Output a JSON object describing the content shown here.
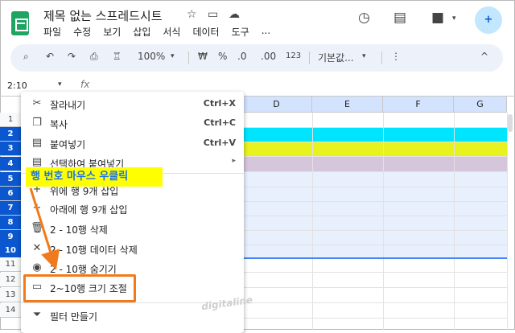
{
  "app": {
    "doc_title": "제목 없는 스프레드시트",
    "title_icons": [
      "star-icon",
      "move-folder-icon",
      "cloud-status-icon"
    ],
    "menu": [
      "파일",
      "수정",
      "보기",
      "삽입",
      "서식",
      "데이터",
      "도구",
      "..."
    ],
    "right_icons": [
      "history-icon",
      "comment-icon",
      "meet-video-icon",
      "share-person-add-icon"
    ],
    "meet_caret": "▾",
    "share_glyph": "+"
  },
  "toolbar": {
    "zoom": "100%",
    "currency": "₩",
    "percent": "%",
    "decrease_decimal": ".0",
    "increase_decimal": ".00",
    "number_format": "123",
    "font_select": "기본값...",
    "more": "⋮",
    "collapse": "^",
    "caret": "▾"
  },
  "formula_bar": {
    "name_box": "2:10",
    "name_box_caret": "▾",
    "fx_label": "fx"
  },
  "grid": {
    "columns": [
      "D",
      "E",
      "F",
      "G"
    ],
    "rows": [
      {
        "label": "1",
        "selected": false
      },
      {
        "label": "2",
        "selected": true
      },
      {
        "label": "3",
        "selected": true
      },
      {
        "label": "4",
        "selected": true
      },
      {
        "label": "5",
        "selected": true
      },
      {
        "label": "6",
        "selected": true
      },
      {
        "label": "7",
        "selected": true
      },
      {
        "label": "8",
        "selected": true
      },
      {
        "label": "9",
        "selected": true
      },
      {
        "label": "10",
        "selected": true
      },
      {
        "label": "11",
        "selected": false
      },
      {
        "label": "12",
        "selected": false
      },
      {
        "label": "13",
        "selected": false
      },
      {
        "label": "14",
        "selected": false
      }
    ],
    "row_fill_colors": {
      "row2": "#00e5ff",
      "row3": "#e8f21e",
      "row4": "#d5c6dc"
    }
  },
  "context_menu": {
    "items": [
      {
        "label": "잘라내기",
        "shortcut": "Ctrl+X",
        "icon": "cut-icon"
      },
      {
        "label": "복사",
        "shortcut": "Ctrl+C",
        "icon": "copy-icon"
      },
      {
        "label": "붙여넣기",
        "shortcut": "Ctrl+V",
        "icon": "paste-icon"
      },
      {
        "label": "선택하여 붙여넣기",
        "shortcut": "▸",
        "icon": "paste-special-icon"
      },
      {
        "label": "위에 행 9개 삽입",
        "shortcut": "",
        "icon": "plus-icon"
      },
      {
        "label": "아래에 행 9개 삽입",
        "shortcut": "",
        "icon": "plus-icon"
      },
      {
        "label": "2 - 10행 삭제",
        "shortcut": "",
        "icon": "trash-icon"
      },
      {
        "label": "2 - 10행 데이터 삭제",
        "shortcut": "",
        "icon": "close-icon"
      },
      {
        "label": "2 - 10행 숨기기",
        "shortcut": "",
        "icon": "eye-hidden-icon"
      },
      {
        "label": "2~10행 크기 조절",
        "shortcut": "",
        "icon": "resize-icon"
      },
      {
        "label": "필터 만들기",
        "shortcut": "",
        "icon": "filter-icon"
      }
    ]
  },
  "annotation": {
    "callout_text": "행 번호 마우스 우클릭",
    "watermark": "digitaline",
    "callout_bg": "#ffff00",
    "callout_text_color": "#1a73e8",
    "highlight_color": "#f07a1c"
  }
}
